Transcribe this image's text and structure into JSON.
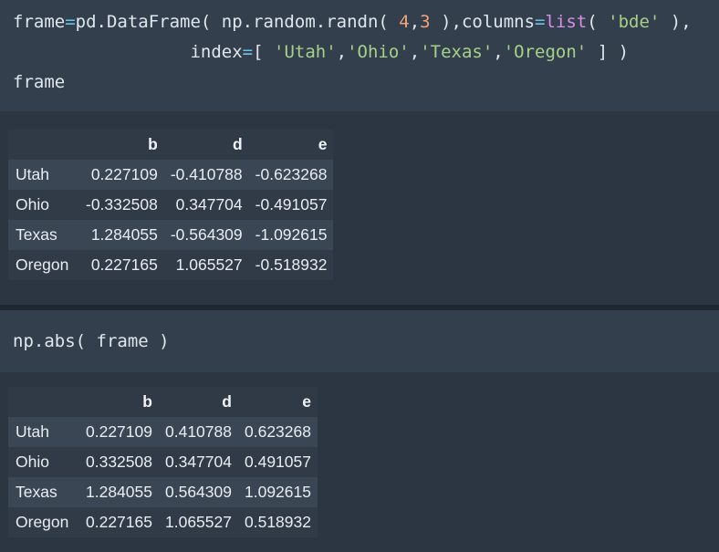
{
  "cell1": {
    "line1": {
      "a": "frame",
      "eq": "=",
      "b": "pd.DataFrame( np.random.randn( ",
      "n1": "4",
      "comma": ",",
      "n2": "3",
      "c": " ),columns",
      "eq2": "=",
      "kw": "list",
      "d": "( ",
      "s": "'bde'",
      "e": " ),"
    },
    "line2": {
      "indent": "                 ",
      "a": "index",
      "eq": "=",
      "b": "[ ",
      "s1": "'Utah'",
      "c1": ",",
      "s2": "'Ohio'",
      "c2": ",",
      "s3": "'Texas'",
      "c3": ",",
      "s4": "'Oregon'",
      "e": " ] )"
    },
    "line3": "frame"
  },
  "table1": {
    "columns": [
      "b",
      "d",
      "e"
    ],
    "rows": [
      {
        "index": "Utah",
        "b": "0.227109",
        "d": "-0.410788",
        "e": "-0.623268"
      },
      {
        "index": "Ohio",
        "b": "-0.332508",
        "d": "0.347704",
        "e": "-0.491057"
      },
      {
        "index": "Texas",
        "b": "1.284055",
        "d": "-0.564309",
        "e": "-1.092615"
      },
      {
        "index": "Oregon",
        "b": "0.227165",
        "d": "1.065527",
        "e": "-0.518932"
      }
    ]
  },
  "cell2": {
    "a": "np.abs( ",
    "b": "frame",
    "c": " )"
  },
  "table2": {
    "columns": [
      "b",
      "d",
      "e"
    ],
    "rows": [
      {
        "index": "Utah",
        "b": "0.227109",
        "d": "0.410788",
        "e": "0.623268"
      },
      {
        "index": "Ohio",
        "b": "0.332508",
        "d": "0.347704",
        "e": "0.491057"
      },
      {
        "index": "Texas",
        "b": "1.284055",
        "d": "0.564309",
        "e": "1.092615"
      },
      {
        "index": "Oregon",
        "b": "0.227165",
        "d": "1.065527",
        "e": "0.518932"
      }
    ]
  },
  "colors": {
    "background": "#2b3642",
    "code_background": "#333f4c",
    "separator": "#1e262f",
    "operator": "#6fc3e8",
    "number": "#f2a37a",
    "string": "#a6d189",
    "keyword": "#d98ee8"
  }
}
